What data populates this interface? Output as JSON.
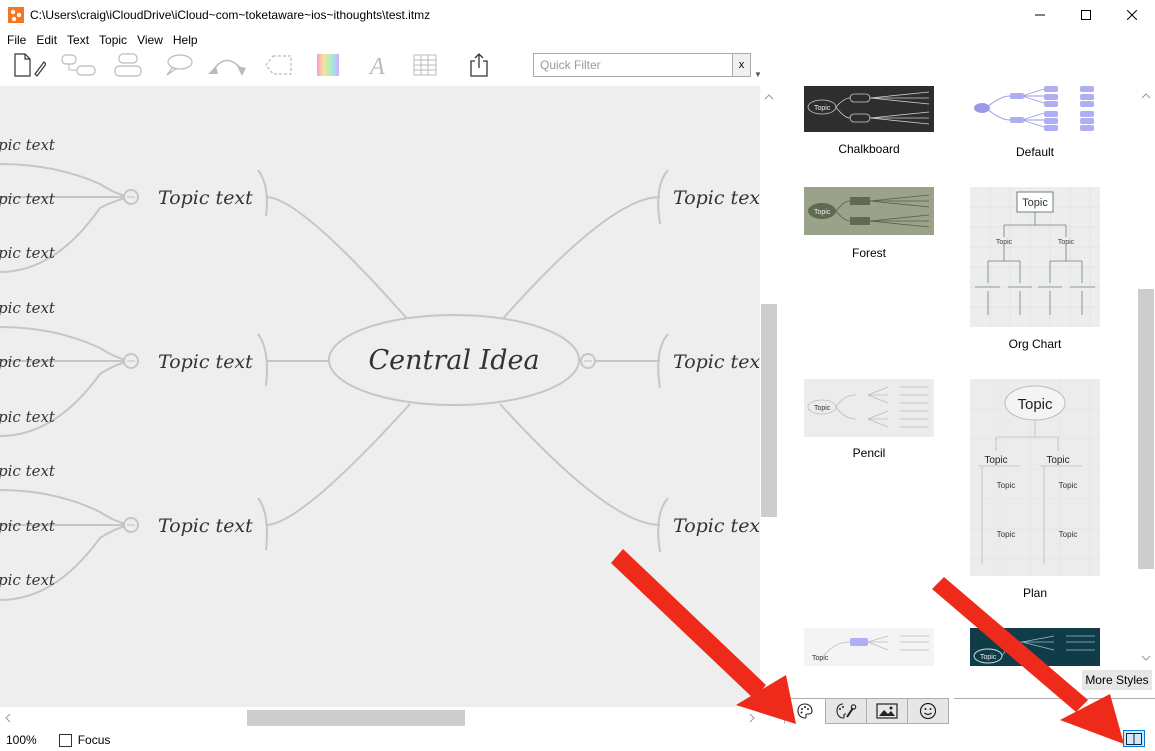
{
  "window": {
    "title": "C:\\Users\\craig\\iCloudDrive\\iCloud~com~toketaware~ios~ithoughts\\test.itmz",
    "minimize_icon": "minimize-icon",
    "maximize_icon": "maximize-icon",
    "close_icon": "close-icon"
  },
  "menu": [
    "File",
    "Edit",
    "Text",
    "Topic",
    "View",
    "Help"
  ],
  "toolbar": {
    "buttons": [
      "new-document-icon",
      "add-child-topic-icon",
      "add-sibling-topic-icon",
      "callout-icon",
      "relationship-icon",
      "boundary-icon",
      "color-icon",
      "font-icon",
      "table-icon",
      "share-icon"
    ],
    "filter_placeholder": "Quick Filter",
    "filter_clear": "x"
  },
  "canvas": {
    "central": "Central Idea",
    "topic_label": "Topic text",
    "left_topics": [
      "Topic text",
      "Topic text",
      "Topic text"
    ],
    "right_topics": [
      "Topic tex",
      "Topic tex",
      "Topic tex"
    ],
    "leaf_label": "pic text",
    "leaves": [
      "pic text",
      "pic text",
      "pic text",
      "pic text",
      "pic text",
      "pic text",
      "pic text",
      "pic text",
      "pic text"
    ]
  },
  "styles_panel": {
    "styles": [
      {
        "name": "Chalkboard",
        "bg": "#2e2e2e"
      },
      {
        "name": "Default",
        "bg": "#ffffff"
      },
      {
        "name": "Forest",
        "bg": "#9aa28a"
      },
      {
        "name": "Org Chart",
        "bg": "#ededed"
      },
      {
        "name": "Pencil",
        "bg": "#ececec"
      },
      {
        "name": "Plan",
        "bg": "#ececec"
      }
    ],
    "thumb_text": "Topic",
    "more_styles": "More Styles",
    "tabs": [
      "palette-icon",
      "palette-wrench-icon",
      "image-icon",
      "emoji-icon"
    ]
  },
  "status": {
    "zoom": "100%",
    "focus": "Focus",
    "panel_toggle_icon": "panel-toggle-icon"
  },
  "colors": {
    "annotation_arrow": "#ee2a1a",
    "canvas_bg": "#eeeeee",
    "line": "#c4c4c4",
    "chalkboard": "#2e2e2e",
    "forest": "#9aa28a",
    "accent": "#0078d7"
  }
}
